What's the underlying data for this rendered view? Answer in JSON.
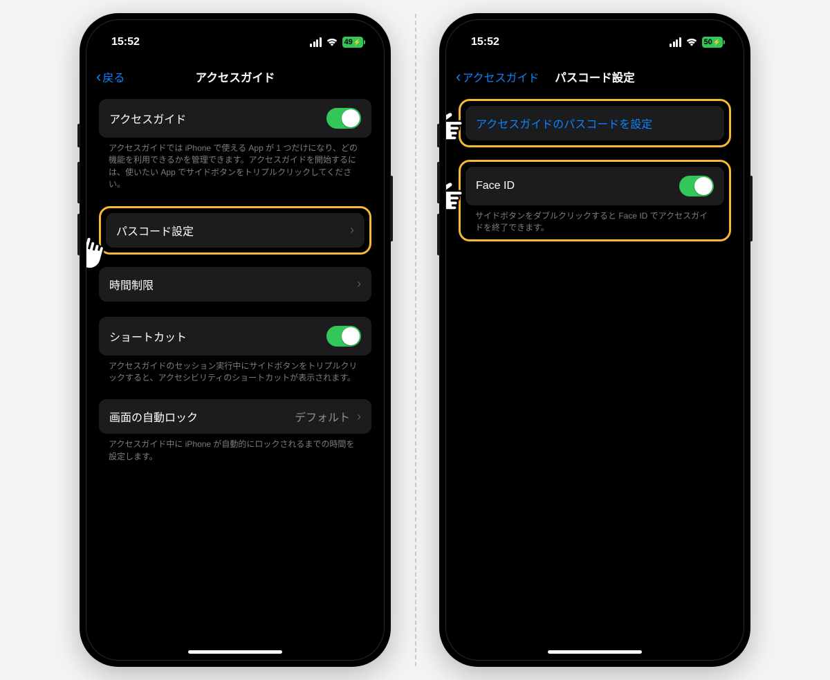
{
  "left": {
    "status": {
      "time": "15:52",
      "battery": "49"
    },
    "nav": {
      "back": "戻る",
      "title": "アクセスガイド"
    },
    "rows": {
      "guided_access": "アクセスガイド",
      "guided_access_desc": "アクセスガイドでは iPhone で使える App が 1 つだけになり、どの機能を利用できるかを管理できます。アクセスガイドを開始するには、使いたい App でサイドボタンをトリプルクリックしてください。",
      "passcode": "パスコード設定",
      "time_limit": "時間制限",
      "shortcut": "ショートカット",
      "shortcut_desc": "アクセスガイドのセッション実行中にサイドボタンをトリプルクリックすると、アクセシビリティのショートカットが表示されます。",
      "auto_lock": "画面の自動ロック",
      "auto_lock_val": "デフォルト",
      "auto_lock_desc": "アクセスガイド中に iPhone が自動的にロックされるまでの時間を設定します。"
    }
  },
  "right": {
    "status": {
      "time": "15:52",
      "battery": "50"
    },
    "nav": {
      "back": "アクセスガイド",
      "title": "パスコード設定"
    },
    "rows": {
      "set_passcode": "アクセスガイドのパスコードを設定",
      "face_id": "Face ID",
      "face_id_desc": "サイドボタンをダブルクリックすると Face ID でアクセスガイドを終了できます。"
    }
  }
}
